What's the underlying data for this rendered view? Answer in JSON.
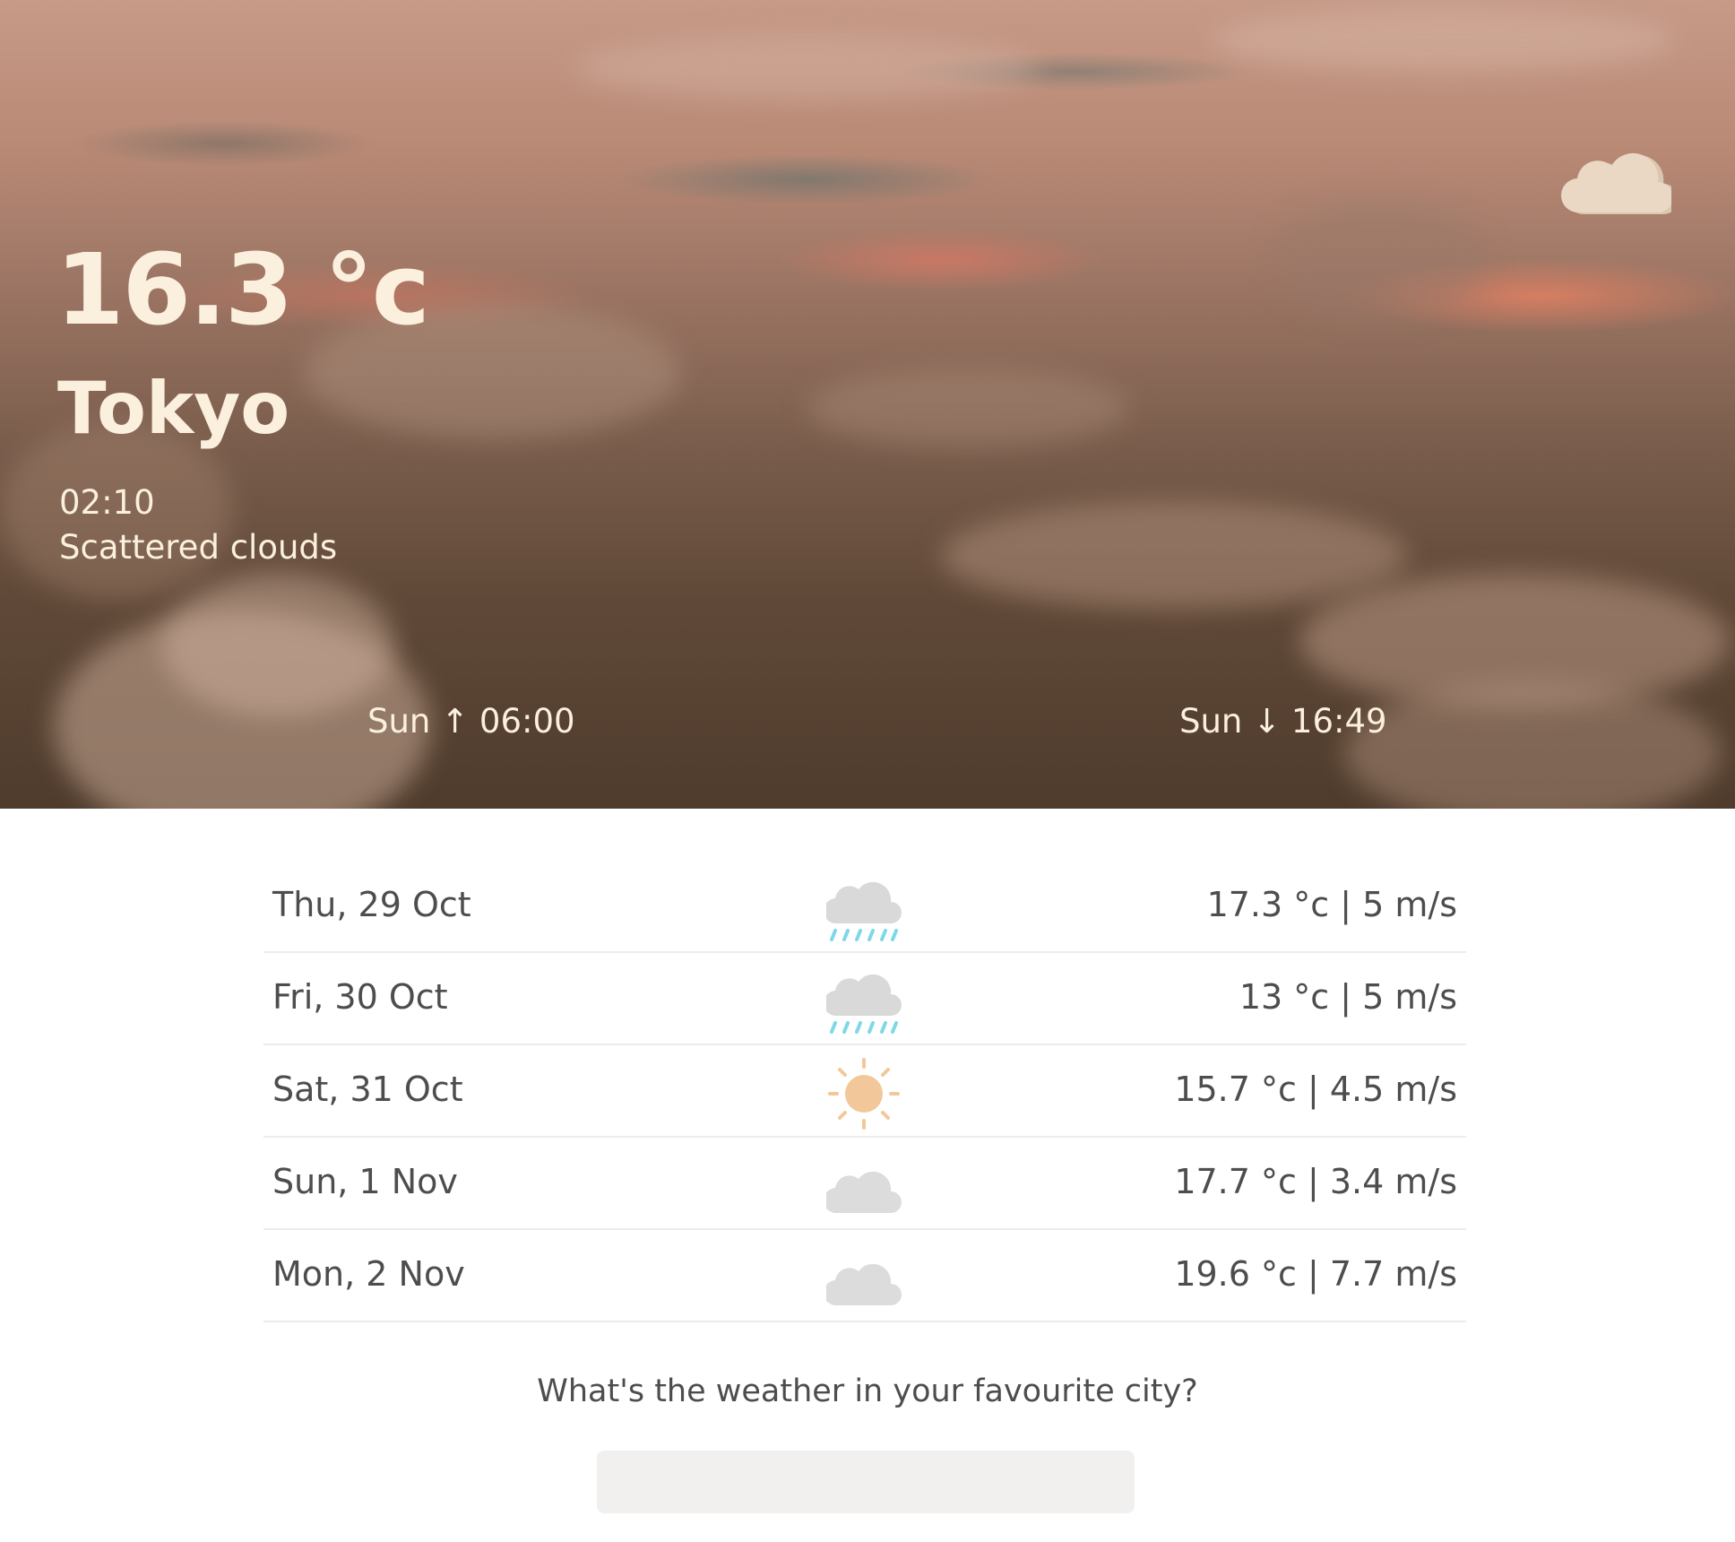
{
  "current": {
    "temperature": "16.3 °c",
    "city": "Tokyo",
    "time": "02:10",
    "description": "Scattered clouds",
    "icon": "cloud-icon",
    "sunrise": "Sun ↑ 06:00",
    "sunset": "Sun ↓ 16:49"
  },
  "forecast": [
    {
      "day": "Thu, 29 Oct",
      "icon": "rain-icon",
      "value": "17.3 °c | 5 m/s"
    },
    {
      "day": "Fri, 30 Oct",
      "icon": "rain-icon",
      "value": "13 °c | 5 m/s"
    },
    {
      "day": "Sat, 31 Oct",
      "icon": "sun-icon",
      "value": "15.7 °c | 4.5 m/s"
    },
    {
      "day": "Sun, 1 Nov",
      "icon": "cloud-icon",
      "value": "17.7 °c | 3.4 m/s"
    },
    {
      "day": "Mon, 2 Nov",
      "icon": "cloud-icon",
      "value": "19.6 °c | 7.7 m/s"
    }
  ],
  "search": {
    "prompt": "What's the weather in your favourite city?",
    "value": "",
    "placeholder": ""
  },
  "colors": {
    "hero_text": "#fbefdd",
    "body_text": "#4d4d4d",
    "divider": "#ececec",
    "input_bg": "#f1f0ef",
    "hero_cloud_icon": "#e8d6c2",
    "forecast_cloud": "#dcdcdc",
    "rain_drops": "#7fd8e8",
    "sun": "#f3c99c"
  }
}
